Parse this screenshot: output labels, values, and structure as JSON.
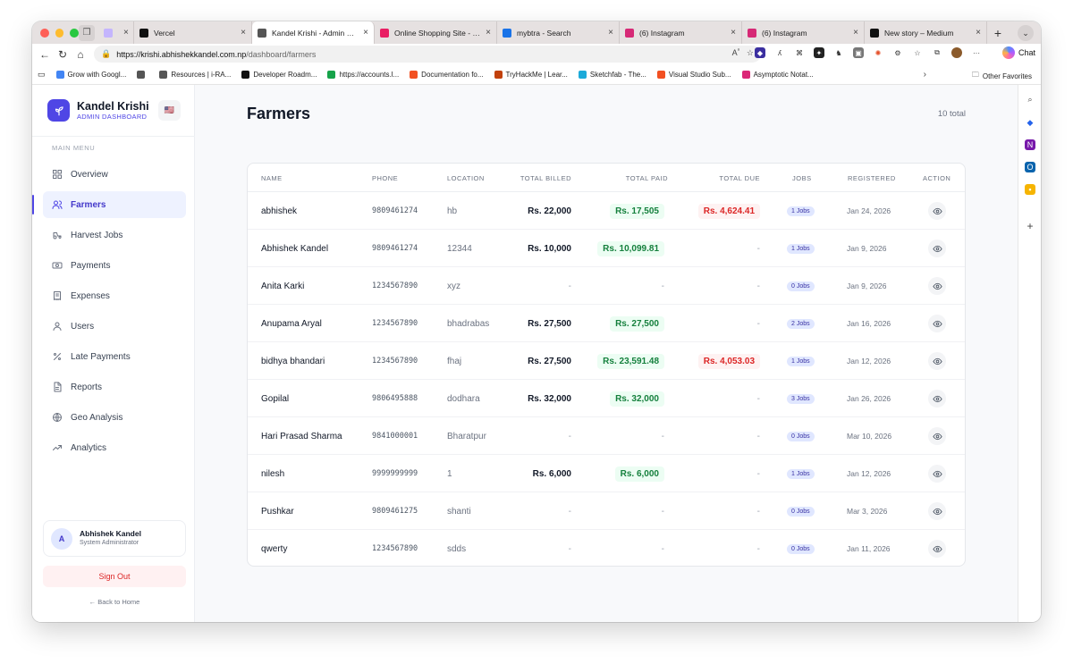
{
  "browser": {
    "tabs": [
      {
        "title": "",
        "favicon": "h-icon",
        "color": "#c4b5fd"
      },
      {
        "title": "Vercel",
        "favicon": "vercel-icon",
        "color": "#111111"
      },
      {
        "title": "Kandel Krishi - Admin Dashb",
        "favicon": "calendar-icon",
        "color": "#555555",
        "active": true
      },
      {
        "title": "Online Shopping Site - Shop",
        "favicon": "myntra-icon",
        "color": "#e91e63"
      },
      {
        "title": "mybtra - Search",
        "favicon": "search-icon",
        "color": "#1a73e8"
      },
      {
        "title": "(6) Instagram",
        "favicon": "instagram-icon",
        "color": "#d62976"
      },
      {
        "title": "(6) Instagram",
        "favicon": "instagram-icon",
        "color": "#d62976"
      },
      {
        "title": "New story – Medium",
        "favicon": "medium-icon",
        "color": "#111111"
      }
    ],
    "url_host": "https://krishi.abhishekkandel.com.np",
    "url_path": "/dashboard/farmers",
    "chat_label": "Chat",
    "bookmarks": [
      {
        "label": "Grow with Googl...",
        "color": "#4285f4"
      },
      {
        "label": "",
        "color": "#555555"
      },
      {
        "label": "Resources | i-RA...",
        "color": "#555555"
      },
      {
        "label": "Developer Roadm...",
        "color": "#111111"
      },
      {
        "label": "https://accounts.l...",
        "color": "#16a34a"
      },
      {
        "label": "Documentation fo...",
        "color": "#f25022"
      },
      {
        "label": "TryHackMe | Lear...",
        "color": "#c2410c"
      },
      {
        "label": "Sketchfab - The...",
        "color": "#1caad9"
      },
      {
        "label": "Visual Studio Sub...",
        "color": "#f25022"
      },
      {
        "label": "Asymptotic Notat...",
        "color": "#db2777"
      }
    ],
    "other_favorites": "Other Favorites"
  },
  "sidebar": {
    "brand_name": "Kandel Krishi",
    "brand_sub": "ADMIN DASHBOARD",
    "flag": "🇺🇸",
    "menu_heading": "MAIN MENU",
    "items": [
      {
        "label": "Overview",
        "icon": "grid-icon"
      },
      {
        "label": "Farmers",
        "icon": "users-icon",
        "active": true
      },
      {
        "label": "Harvest Jobs",
        "icon": "tractor-icon"
      },
      {
        "label": "Payments",
        "icon": "cash-icon"
      },
      {
        "label": "Expenses",
        "icon": "receipt-icon"
      },
      {
        "label": "Users",
        "icon": "user-icon"
      },
      {
        "label": "Late Payments",
        "icon": "percent-icon"
      },
      {
        "label": "Reports",
        "icon": "file-icon"
      },
      {
        "label": "Geo Analysis",
        "icon": "globe-icon"
      },
      {
        "label": "Analytics",
        "icon": "trend-icon"
      }
    ],
    "user": {
      "initial": "A",
      "name": "Abhishek Kandel",
      "role": "System Administrator"
    },
    "signout_label": "Sign Out",
    "back_home_label": "← Back to Home"
  },
  "main": {
    "title": "Farmers",
    "total": "10 total",
    "columns": [
      "NAME",
      "PHONE",
      "LOCATION",
      "TOTAL BILLED",
      "TOTAL PAID",
      "TOTAL DUE",
      "JOBS",
      "REGISTERED",
      "ACTION"
    ],
    "rows": [
      {
        "name": "abhishek",
        "phone": "9809461274",
        "location": "hb",
        "billed": "Rs. 22,000",
        "paid": "Rs. 17,505",
        "due": "Rs. 4,624.41",
        "jobs": "1 Jobs",
        "registered": "Jan 24, 2026"
      },
      {
        "name": "Abhishek Kandel",
        "phone": "9809461274",
        "location": "12344",
        "billed": "Rs. 10,000",
        "paid": "Rs. 10,099.81",
        "due": "-",
        "jobs": "1 Jobs",
        "registered": "Jan 9, 2026"
      },
      {
        "name": "Anita Karki",
        "phone": "1234567890",
        "location": "xyz",
        "billed": "-",
        "paid": "-",
        "due": "-",
        "jobs": "0 Jobs",
        "registered": "Jan 9, 2026"
      },
      {
        "name": "Anupama Aryal",
        "phone": "1234567890",
        "location": "bhadrabas",
        "billed": "Rs. 27,500",
        "paid": "Rs. 27,500",
        "due": "-",
        "jobs": "2 Jobs",
        "registered": "Jan 16, 2026"
      },
      {
        "name": "bidhya bhandari",
        "phone": "1234567890",
        "location": "fhaj",
        "billed": "Rs. 27,500",
        "paid": "Rs. 23,591.48",
        "due": "Rs. 4,053.03",
        "jobs": "1 Jobs",
        "registered": "Jan 12, 2026"
      },
      {
        "name": "Gopilal",
        "phone": "9806495888",
        "location": "dodhara",
        "billed": "Rs. 32,000",
        "paid": "Rs. 32,000",
        "due": "-",
        "jobs": "3 Jobs",
        "registered": "Jan 26, 2026"
      },
      {
        "name": "Hari Prasad Sharma",
        "phone": "9841000001",
        "location": "Bharatpur",
        "billed": "-",
        "paid": "-",
        "due": "-",
        "jobs": "0 Jobs",
        "registered": "Mar 10, 2026"
      },
      {
        "name": "nilesh",
        "phone": "9999999999",
        "location": "1",
        "billed": "Rs. 6,000",
        "paid": "Rs. 6,000",
        "due": "-",
        "jobs": "1 Jobs",
        "registered": "Jan 12, 2026"
      },
      {
        "name": "Pushkar",
        "phone": "9809461275",
        "location": "shanti",
        "billed": "-",
        "paid": "-",
        "due": "-",
        "jobs": "0 Jobs",
        "registered": "Mar 3, 2026"
      },
      {
        "name": "qwerty",
        "phone": "1234567890",
        "location": "sdds",
        "billed": "-",
        "paid": "-",
        "due": "-",
        "jobs": "0 Jobs",
        "registered": "Jan 11, 2026"
      }
    ]
  },
  "colors": {
    "accent": "#4f46e5",
    "paid": "#15803d",
    "due": "#dc2626"
  }
}
